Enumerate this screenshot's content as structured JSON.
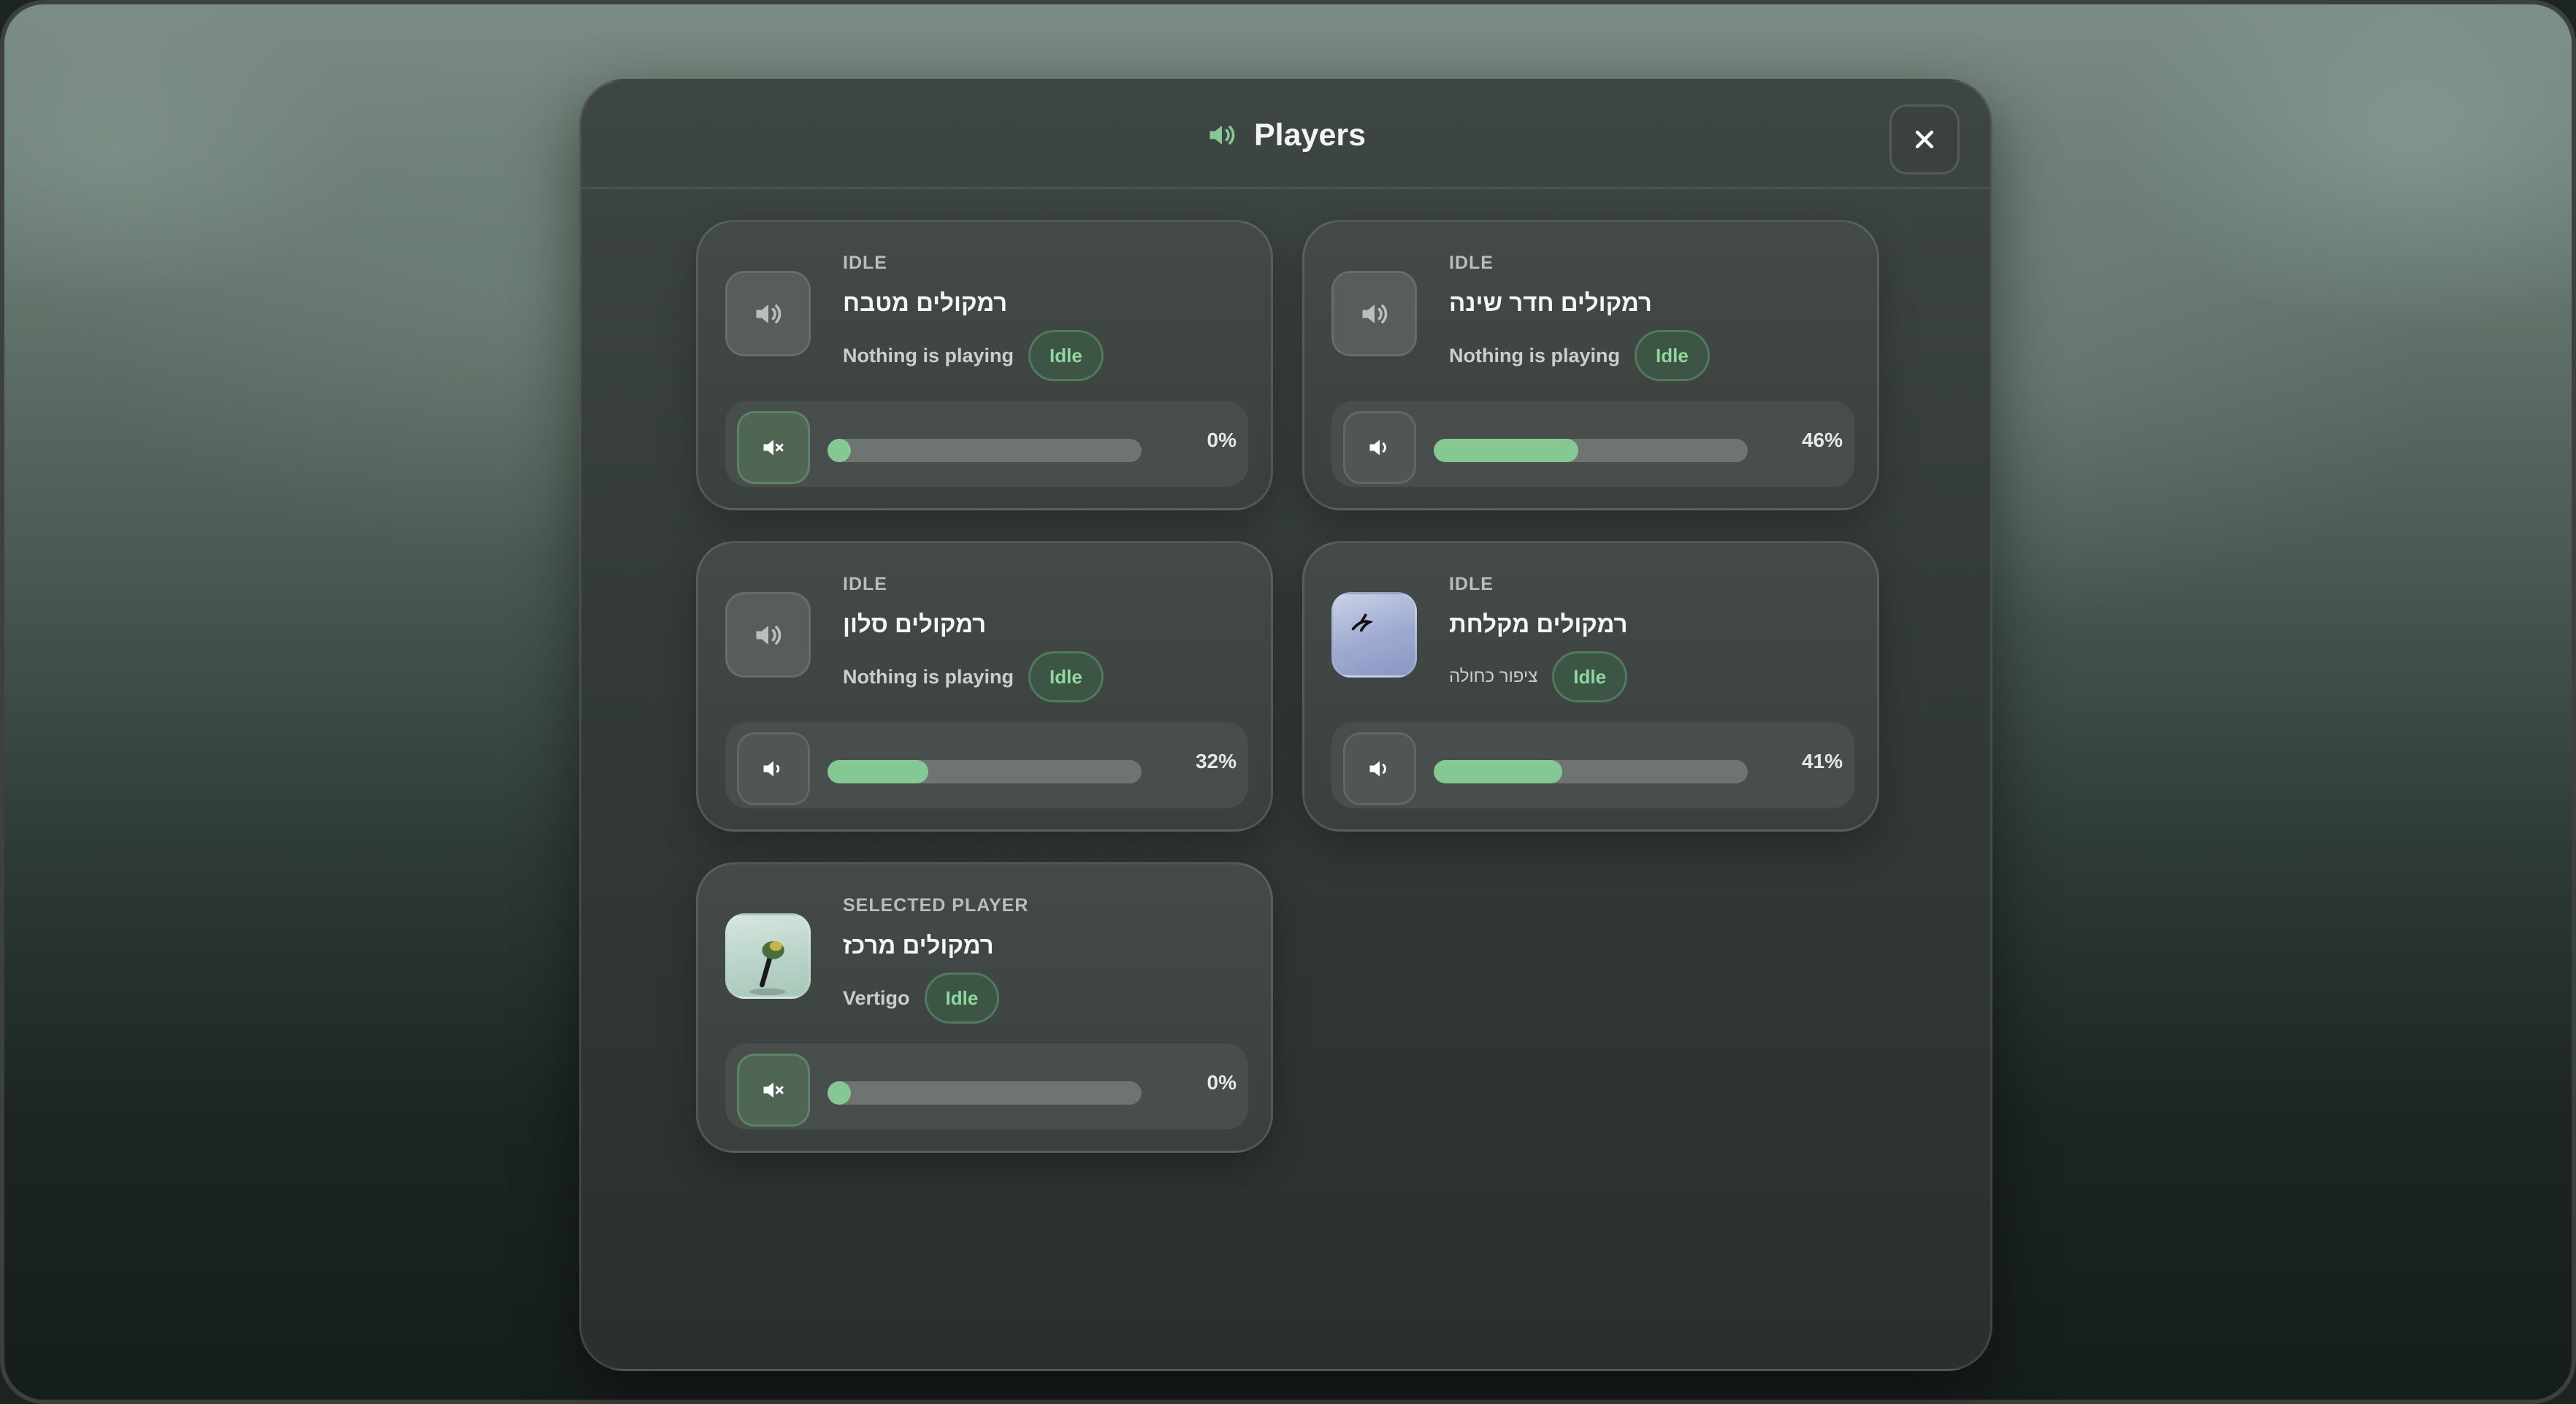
{
  "modal": {
    "title": "Players",
    "close_icon": "close-icon",
    "title_icon": "speaker-icon",
    "accent": "#86c893"
  },
  "players": [
    {
      "state": "IDLE",
      "name": "רמקולים מטבח",
      "now_playing": "Nothing is playing",
      "badge": "Idle",
      "volume_pct": 0,
      "volume_label": "0%",
      "muted": true,
      "art": "speaker-icon"
    },
    {
      "state": "IDLE",
      "name": "רמקולים חדר שינה",
      "now_playing": "Nothing is playing",
      "badge": "Idle",
      "volume_pct": 46,
      "volume_label": "46%",
      "muted": false,
      "art": "speaker-icon"
    },
    {
      "state": "IDLE",
      "name": "רמקולים סלון",
      "now_playing": "Nothing is playing",
      "badge": "Idle",
      "volume_pct": 32,
      "volume_label": "32%",
      "muted": false,
      "art": "speaker-icon"
    },
    {
      "state": "IDLE",
      "name": "רמקולים מקלחת",
      "now_playing": "ציפור כחולה",
      "badge": "Idle",
      "volume_pct": 41,
      "volume_label": "41%",
      "muted": false,
      "art": "album-art-bird"
    },
    {
      "state": "SELECTED PLAYER",
      "name": "רמקולים מרכז",
      "now_playing": "Vertigo",
      "badge": "Idle",
      "volume_pct": 0,
      "volume_label": "0%",
      "muted": true,
      "art": "album-art-vertigo"
    }
  ]
}
